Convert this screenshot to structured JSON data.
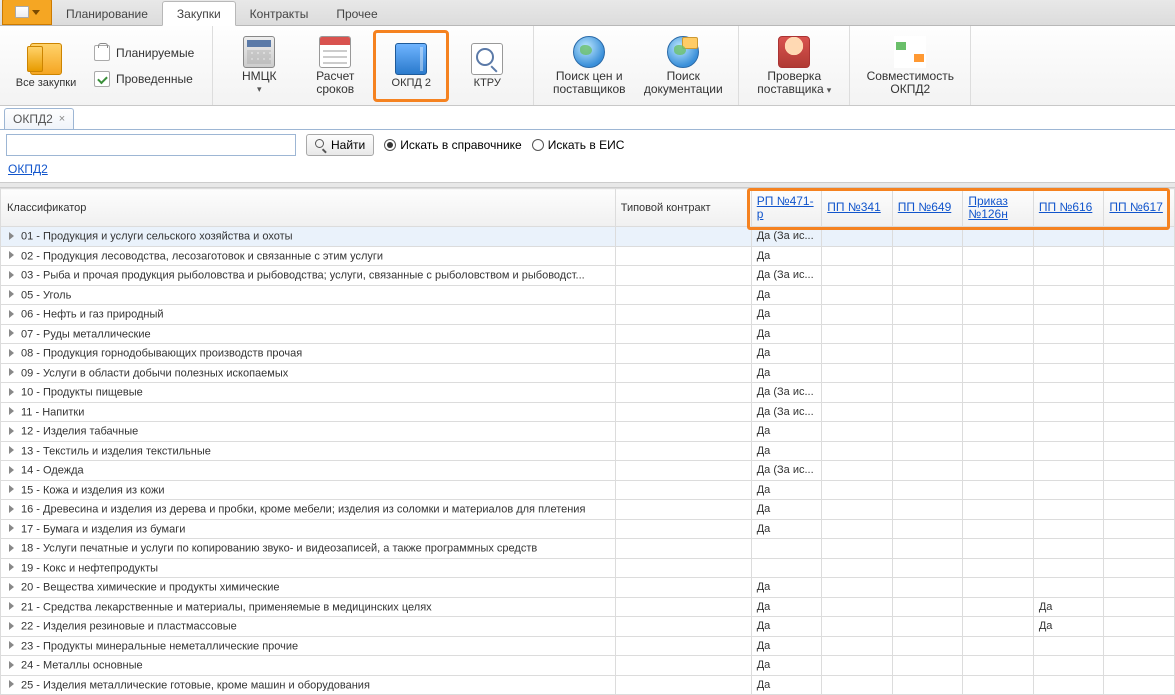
{
  "tabs": {
    "planning": "Планирование",
    "purchases": "Закупки",
    "contracts": "Контракты",
    "other": "Прочее"
  },
  "ribbon": {
    "all_purchases": "Все закупки",
    "planned": "Планируемые",
    "conducted": "Проведенные",
    "nmck": "НМЦК",
    "calc_terms_l1": "Расчет",
    "calc_terms_l2": "сроков",
    "okpd2": "ОКПД 2",
    "ktru": "КТРУ",
    "price_search_l1": "Поиск цен и",
    "price_search_l2": "поставщиков",
    "doc_search_l1": "Поиск",
    "doc_search_l2": "документации",
    "supplier_check_l1": "Проверка",
    "supplier_check_l2": "поставщика",
    "compat_l1": "Совместимость",
    "compat_l2": "ОКПД2"
  },
  "doc_tab": {
    "label": "ОКПД2"
  },
  "search": {
    "placeholder": "",
    "find_btn": "Найти",
    "opt_dir": "Искать в справочнике",
    "opt_eis": "Искать в ЕИС"
  },
  "breadcrumb": {
    "root": "ОКПД2"
  },
  "columns": {
    "classifier": "Классификатор",
    "typical_contract": "Типовой контракт",
    "rp471": "РП №471-р",
    "pp341": "ПП №341",
    "pp649": "ПП №649",
    "order126": "Приказ №126н",
    "pp616": "ПП №616",
    "pp617": "ПП №617"
  },
  "vals": {
    "da": "Да",
    "da_ex": "Да (За ис..."
  },
  "rows": [
    {
      "name": "01 - Продукция и услуги сельского хозяйства и охоты",
      "rp471": "da_ex",
      "sel": true
    },
    {
      "name": "02 - Продукция лесоводства, лесозаготовок и связанные с этим услуги",
      "rp471": "da"
    },
    {
      "name": "03 - Рыба и прочая продукция рыболовства и рыбоводства; услуги, связанные с рыболовством и рыбоводст...",
      "rp471": "da_ex"
    },
    {
      "name": "05 - Уголь",
      "rp471": "da"
    },
    {
      "name": "06 - Нефть и газ природный",
      "rp471": "da"
    },
    {
      "name": "07 - Руды металлические",
      "rp471": "da"
    },
    {
      "name": "08 - Продукция горнодобывающих производств прочая",
      "rp471": "da"
    },
    {
      "name": "09 - Услуги в области добычи полезных ископаемых",
      "rp471": "da"
    },
    {
      "name": "10 - Продукты пищевые",
      "rp471": "da_ex"
    },
    {
      "name": "11 - Напитки",
      "rp471": "da_ex"
    },
    {
      "name": "12 - Изделия табачные",
      "rp471": "da"
    },
    {
      "name": "13 - Текстиль и изделия текстильные",
      "rp471": "da"
    },
    {
      "name": "14 - Одежда",
      "rp471": "da_ex"
    },
    {
      "name": "15 - Кожа и изделия из кожи",
      "rp471": "da"
    },
    {
      "name": "16 - Древесина и изделия из дерева и пробки, кроме мебели; изделия из соломки и материалов для плетения",
      "rp471": "da"
    },
    {
      "name": "17 - Бумага и изделия из бумаги",
      "rp471": "da"
    },
    {
      "name": "18 - Услуги печатные и услуги по копированию звуко- и видеозаписей, а также программных средств"
    },
    {
      "name": "19 - Кокс и нефтепродукты"
    },
    {
      "name": "20 - Вещества химические и продукты химические",
      "rp471": "da"
    },
    {
      "name": "21 - Средства лекарственные и материалы, применяемые в медицинских целях",
      "rp471": "da",
      "pp616": "da"
    },
    {
      "name": "22 - Изделия резиновые и пластмассовые",
      "rp471": "da",
      "pp616": "da"
    },
    {
      "name": "23 - Продукты минеральные неметаллические прочие",
      "rp471": "da"
    },
    {
      "name": "24 - Металлы основные",
      "rp471": "da"
    },
    {
      "name": "25 - Изделия металлические готовые, кроме машин и оборудования",
      "rp471": "da"
    }
  ]
}
